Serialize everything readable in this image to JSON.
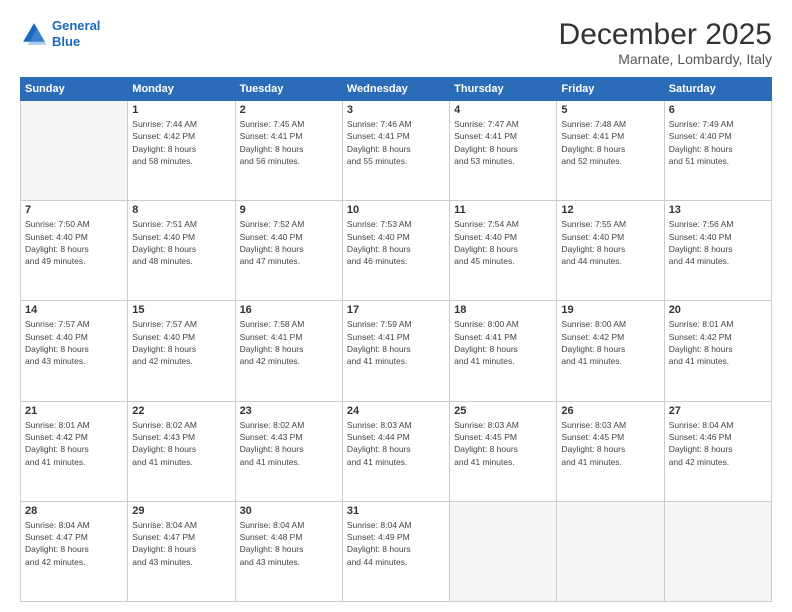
{
  "header": {
    "logo_line1": "General",
    "logo_line2": "Blue",
    "title": "December 2025",
    "subtitle": "Marnate, Lombardy, Italy"
  },
  "days_of_week": [
    "Sunday",
    "Monday",
    "Tuesday",
    "Wednesday",
    "Thursday",
    "Friday",
    "Saturday"
  ],
  "weeks": [
    [
      {
        "num": "",
        "info": ""
      },
      {
        "num": "1",
        "info": "Sunrise: 7:44 AM\nSunset: 4:42 PM\nDaylight: 8 hours\nand 58 minutes."
      },
      {
        "num": "2",
        "info": "Sunrise: 7:45 AM\nSunset: 4:41 PM\nDaylight: 8 hours\nand 56 minutes."
      },
      {
        "num": "3",
        "info": "Sunrise: 7:46 AM\nSunset: 4:41 PM\nDaylight: 8 hours\nand 55 minutes."
      },
      {
        "num": "4",
        "info": "Sunrise: 7:47 AM\nSunset: 4:41 PM\nDaylight: 8 hours\nand 53 minutes."
      },
      {
        "num": "5",
        "info": "Sunrise: 7:48 AM\nSunset: 4:41 PM\nDaylight: 8 hours\nand 52 minutes."
      },
      {
        "num": "6",
        "info": "Sunrise: 7:49 AM\nSunset: 4:40 PM\nDaylight: 8 hours\nand 51 minutes."
      }
    ],
    [
      {
        "num": "7",
        "info": "Sunrise: 7:50 AM\nSunset: 4:40 PM\nDaylight: 8 hours\nand 49 minutes."
      },
      {
        "num": "8",
        "info": "Sunrise: 7:51 AM\nSunset: 4:40 PM\nDaylight: 8 hours\nand 48 minutes."
      },
      {
        "num": "9",
        "info": "Sunrise: 7:52 AM\nSunset: 4:40 PM\nDaylight: 8 hours\nand 47 minutes."
      },
      {
        "num": "10",
        "info": "Sunrise: 7:53 AM\nSunset: 4:40 PM\nDaylight: 8 hours\nand 46 minutes."
      },
      {
        "num": "11",
        "info": "Sunrise: 7:54 AM\nSunset: 4:40 PM\nDaylight: 8 hours\nand 45 minutes."
      },
      {
        "num": "12",
        "info": "Sunrise: 7:55 AM\nSunset: 4:40 PM\nDaylight: 8 hours\nand 44 minutes."
      },
      {
        "num": "13",
        "info": "Sunrise: 7:56 AM\nSunset: 4:40 PM\nDaylight: 8 hours\nand 44 minutes."
      }
    ],
    [
      {
        "num": "14",
        "info": "Sunrise: 7:57 AM\nSunset: 4:40 PM\nDaylight: 8 hours\nand 43 minutes."
      },
      {
        "num": "15",
        "info": "Sunrise: 7:57 AM\nSunset: 4:40 PM\nDaylight: 8 hours\nand 42 minutes."
      },
      {
        "num": "16",
        "info": "Sunrise: 7:58 AM\nSunset: 4:41 PM\nDaylight: 8 hours\nand 42 minutes."
      },
      {
        "num": "17",
        "info": "Sunrise: 7:59 AM\nSunset: 4:41 PM\nDaylight: 8 hours\nand 41 minutes."
      },
      {
        "num": "18",
        "info": "Sunrise: 8:00 AM\nSunset: 4:41 PM\nDaylight: 8 hours\nand 41 minutes."
      },
      {
        "num": "19",
        "info": "Sunrise: 8:00 AM\nSunset: 4:42 PM\nDaylight: 8 hours\nand 41 minutes."
      },
      {
        "num": "20",
        "info": "Sunrise: 8:01 AM\nSunset: 4:42 PM\nDaylight: 8 hours\nand 41 minutes."
      }
    ],
    [
      {
        "num": "21",
        "info": "Sunrise: 8:01 AM\nSunset: 4:42 PM\nDaylight: 8 hours\nand 41 minutes."
      },
      {
        "num": "22",
        "info": "Sunrise: 8:02 AM\nSunset: 4:43 PM\nDaylight: 8 hours\nand 41 minutes."
      },
      {
        "num": "23",
        "info": "Sunrise: 8:02 AM\nSunset: 4:43 PM\nDaylight: 8 hours\nand 41 minutes."
      },
      {
        "num": "24",
        "info": "Sunrise: 8:03 AM\nSunset: 4:44 PM\nDaylight: 8 hours\nand 41 minutes."
      },
      {
        "num": "25",
        "info": "Sunrise: 8:03 AM\nSunset: 4:45 PM\nDaylight: 8 hours\nand 41 minutes."
      },
      {
        "num": "26",
        "info": "Sunrise: 8:03 AM\nSunset: 4:45 PM\nDaylight: 8 hours\nand 41 minutes."
      },
      {
        "num": "27",
        "info": "Sunrise: 8:04 AM\nSunset: 4:46 PM\nDaylight: 8 hours\nand 42 minutes."
      }
    ],
    [
      {
        "num": "28",
        "info": "Sunrise: 8:04 AM\nSunset: 4:47 PM\nDaylight: 8 hours\nand 42 minutes."
      },
      {
        "num": "29",
        "info": "Sunrise: 8:04 AM\nSunset: 4:47 PM\nDaylight: 8 hours\nand 43 minutes."
      },
      {
        "num": "30",
        "info": "Sunrise: 8:04 AM\nSunset: 4:48 PM\nDaylight: 8 hours\nand 43 minutes."
      },
      {
        "num": "31",
        "info": "Sunrise: 8:04 AM\nSunset: 4:49 PM\nDaylight: 8 hours\nand 44 minutes."
      },
      {
        "num": "",
        "info": ""
      },
      {
        "num": "",
        "info": ""
      },
      {
        "num": "",
        "info": ""
      }
    ]
  ]
}
